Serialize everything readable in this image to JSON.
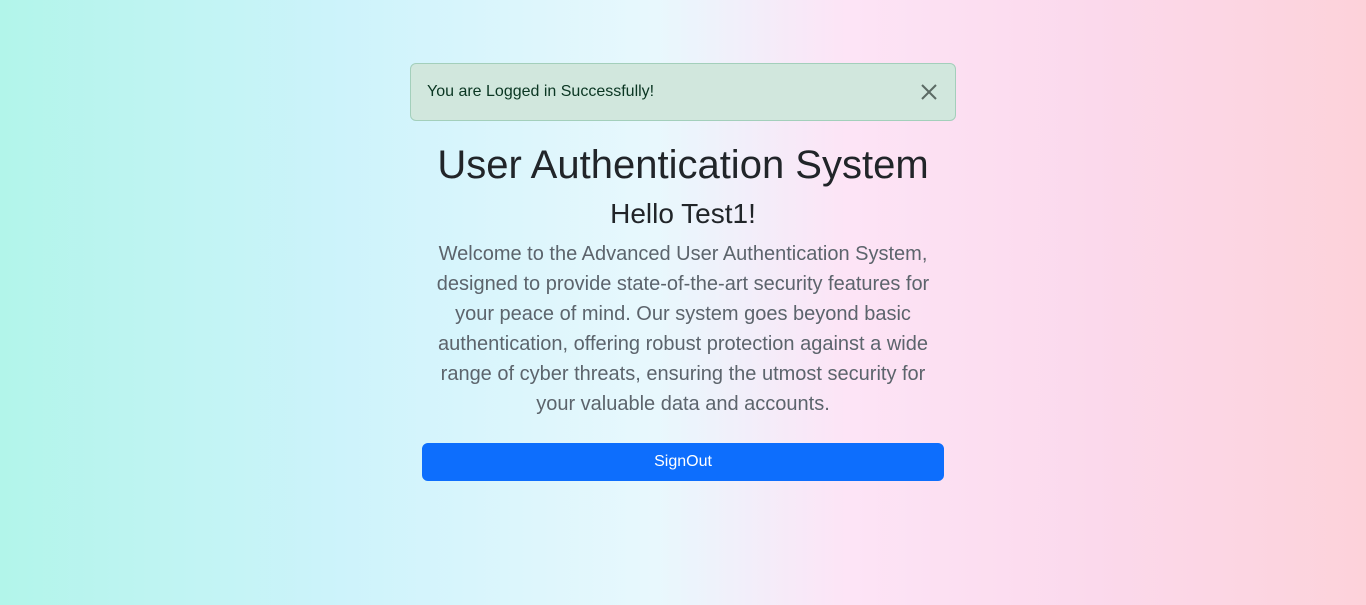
{
  "alert": {
    "message": "You are Logged in Successfully!",
    "close_icon": "close-icon"
  },
  "main": {
    "title": "User Authentication System",
    "greeting": "Hello Test1!",
    "description": "Welcome to the Advanced User Authentication System, designed to provide state-of-the-art security features for your peace of mind. Our system goes beyond basic authentication, offering robust protection against a wide range of cyber threats, ensuring the utmost security for your valuable data and accounts.",
    "signout_label": "SignOut"
  },
  "colors": {
    "primary": "#0d6efd",
    "alert_bg": "#d1e7dd",
    "alert_text": "#0a3622"
  }
}
